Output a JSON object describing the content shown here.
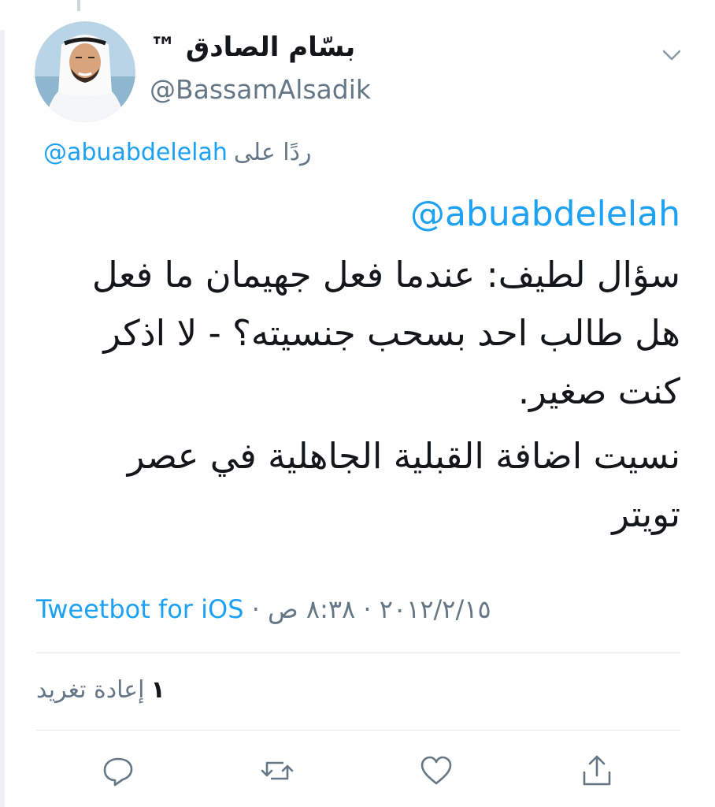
{
  "tweet": {
    "author": {
      "display_name": "بسّام الصادق ™",
      "handle": "@BassamAlsadik",
      "avatar_icon": "profile-photo"
    },
    "reply_to": {
      "prefix": "ردًا على",
      "handle": "@abuabdelelah"
    },
    "body": {
      "mention": "@abuabdelelah",
      "paragraph_1": "سؤال لطيف: عندما فعل جهيمان ما فعل هل طالب احد بسحب جنسيته؟ - لا اذكر كنت صغير.",
      "paragraph_2": "نسيت اضافة القبلية الجاهلية في عصر تويتر"
    },
    "meta": {
      "time": "٨:٣٨ ص",
      "separator": "·",
      "date": "٢٠١٢/٢/١٥",
      "source": "Tweetbot for iOS"
    },
    "stats": {
      "retweet_count": "١",
      "retweet_label": "إعادة تغريد"
    },
    "actions": [
      {
        "name": "reply-icon"
      },
      {
        "name": "retweet-icon"
      },
      {
        "name": "like-icon"
      },
      {
        "name": "share-icon"
      }
    ]
  },
  "colors": {
    "accent": "#1da1f2",
    "secondary_text": "#657786",
    "primary_text": "#14171a",
    "divider": "#e1e8ed"
  }
}
